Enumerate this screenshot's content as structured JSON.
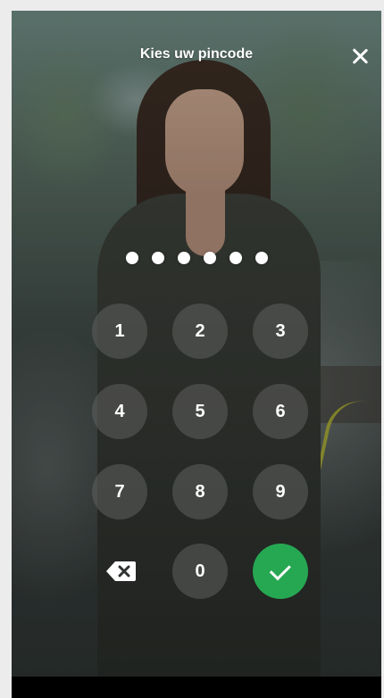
{
  "header": {
    "title": "Kies uw pincode",
    "close_icon": "close-icon"
  },
  "pin": {
    "entered_digits": 6,
    "max_digits": 6
  },
  "keypad": {
    "keys": [
      "1",
      "2",
      "3",
      "4",
      "5",
      "6",
      "7",
      "8",
      "9",
      "0"
    ],
    "backspace_icon": "backspace-icon",
    "confirm_icon": "check-icon"
  },
  "colors": {
    "confirm": "#26a852",
    "key_background": "rgba(95,97,95,0.55)",
    "text": "#ffffff"
  }
}
